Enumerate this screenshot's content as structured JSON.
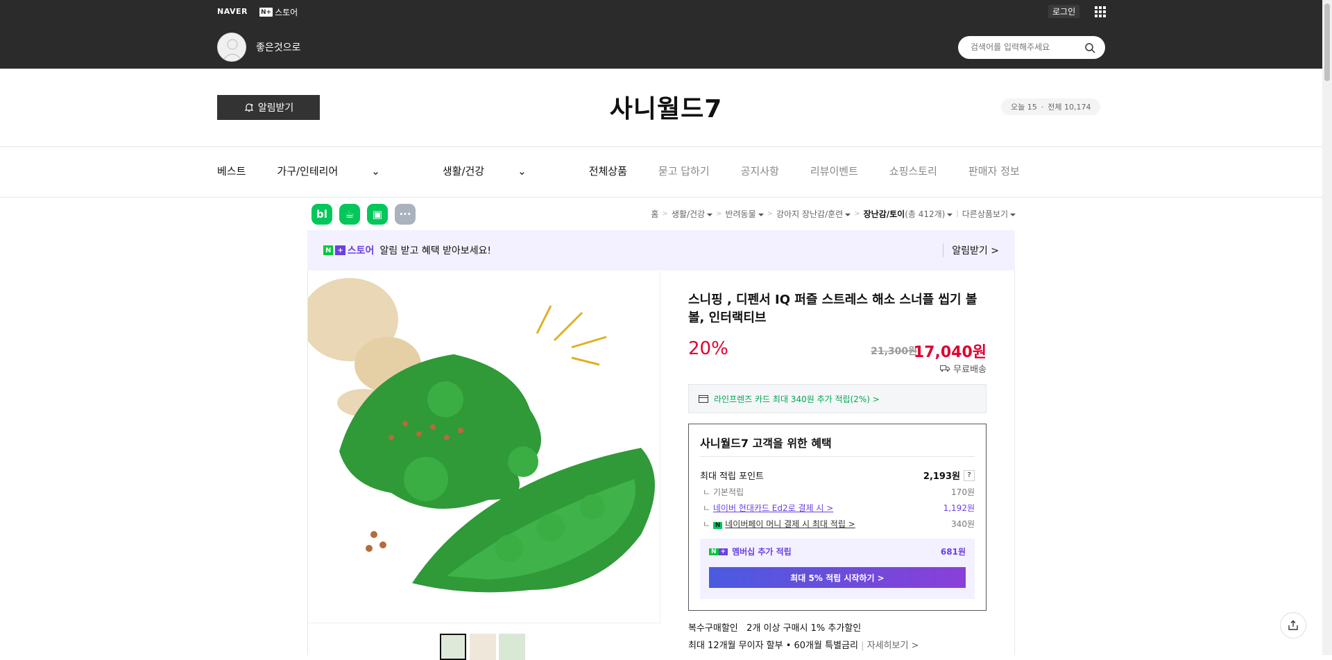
{
  "header": {
    "naver_label": "NAVER",
    "nplus_badge": "N+",
    "nplus_store_label": "스토어",
    "login_label": "로그인",
    "seller_name": "좋은것으로",
    "search_placeholder": "검색어를 입력해주세요"
  },
  "store": {
    "alarm_label": "알림받기",
    "title": "사니월드7",
    "today_label": "오늘 15",
    "total_label": "전체 10,174"
  },
  "nav": {
    "items": [
      "베스트",
      "가구/인테리어",
      "생활/건강",
      "전체상품",
      "묻고 답하기",
      "공지사항",
      "리뷰이벤트",
      "쇼핑스토리",
      "판매자 정보"
    ]
  },
  "share": {
    "icons": [
      "bl",
      "☕",
      "▣",
      "···"
    ]
  },
  "breadcrumb": {
    "items": [
      "홈",
      "생활/건강",
      "반려동물",
      "강아지 장난감/훈련",
      "장난감/토이",
      "(총 412개)",
      "다른상품보기"
    ]
  },
  "banner": {
    "n_badge": "N",
    "plus_badge": "+",
    "brand": "스토어",
    "text": "알림 받고 혜택 받아보세요!",
    "action": "알림받기 >"
  },
  "product": {
    "title": "스니핑 , 디펜서 IQ 퍼즐 스트레스 해소 스너플 씹기 볼 볼, 인터랙티브",
    "discount": "20%",
    "original_price": "21,300원",
    "sale_price": "17,040원",
    "shipping": "무료배송",
    "card_benefit": "라인프렌즈 카드 최대 340원 추가 적립(2%) >"
  },
  "benefit": {
    "title": "사니월드7 고객을 위한 혜택",
    "max_points_label": "최대 적립 포인트",
    "max_points_value": "2,193원",
    "question_mark": "?",
    "basic_label": "기본적립",
    "basic_value": "170원",
    "hyundai_label": "네이버 현대카드 Ed2로 결제 시 >",
    "hyundai_value": "1,192원",
    "npay_badge": "N",
    "npay_label": "네이버페이 머니 결제 시 최대 적립 >",
    "npay_value": "340원",
    "membership_n": "N",
    "membership_plus": "+",
    "membership_label": "멤버십 추가 적립",
    "membership_value": "681원",
    "cta": "최대 5% 적립 시작하기 >"
  },
  "extra": {
    "bulk_label": "복수구매할인",
    "bulk_text": "2개 이상 구매시 1% 추가할인",
    "install_text": "최대 12개월 무이자 할부 • 60개월 특별금리",
    "install_more": "자세히보기 >"
  }
}
